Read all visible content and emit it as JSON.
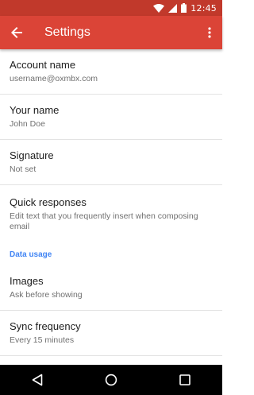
{
  "status": {
    "time": "12:45",
    "icons": [
      "wifi-icon",
      "signal-icon",
      "battery-icon"
    ]
  },
  "app_bar": {
    "title": "Settings",
    "back_icon": "arrow-back-icon",
    "more_icon": "more-vert-icon",
    "color": "#db4437"
  },
  "settings": {
    "account": {
      "label": "Account name",
      "value": "username@oxmbx.com"
    },
    "your_name": {
      "label": "Your name",
      "value": "John Doe"
    },
    "signature": {
      "label": "Signature",
      "value": "Not set"
    },
    "quick_responses": {
      "label": "Quick responses",
      "value": "Edit text that you frequently insert when composing email"
    },
    "data_usage_header": "Data usage",
    "images": {
      "label": "Images",
      "value": "Ask before showing"
    },
    "sync_frequency": {
      "label": "Sync frequency",
      "value": "Every 15 minutes"
    }
  },
  "nav": {
    "back": "nav-back-icon",
    "home": "nav-home-icon",
    "recents": "nav-recents-icon"
  }
}
